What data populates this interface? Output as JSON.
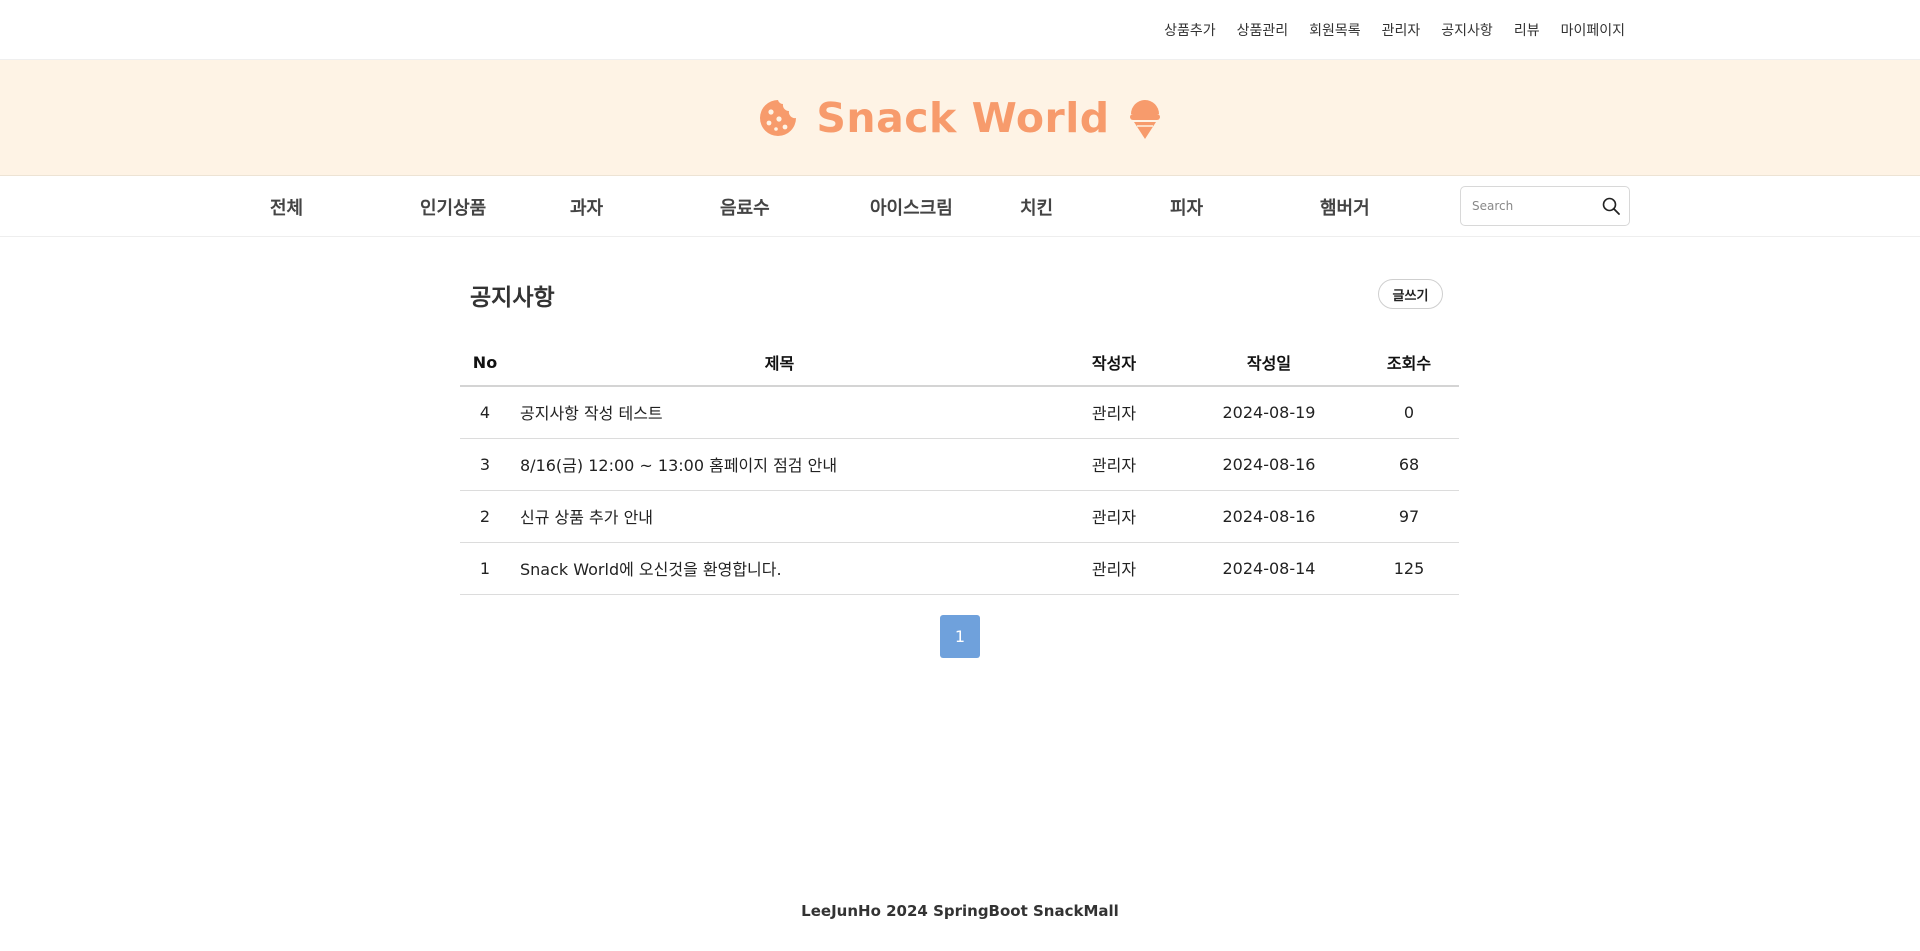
{
  "top_nav": [
    "상품추가",
    "상품관리",
    "회원목록",
    "관리자",
    "공지사항",
    "리뷰",
    "마이페이지"
  ],
  "brand": {
    "title": "Snack World",
    "color": "#f79b6c",
    "left_icon": "cookie-icon",
    "right_icon": "ice-cream-icon"
  },
  "categories": [
    "전체",
    "인기상품",
    "과자",
    "음료수",
    "아이스크림",
    "치킨",
    "피자",
    "햄버거"
  ],
  "search": {
    "placeholder": "Search",
    "icon": "search-icon"
  },
  "notice": {
    "title": "공지사항",
    "write_label": "글쓰기",
    "columns": [
      "No",
      "제목",
      "작성자",
      "작성일",
      "조회수"
    ],
    "rows": [
      {
        "no": "4",
        "title": "공지사항 작성 테스트",
        "author": "관리자",
        "date": "2024-08-19",
        "views": "0"
      },
      {
        "no": "3",
        "title": "8/16(금) 12:00 ~ 13:00 홈페이지 점검 안내",
        "author": "관리자",
        "date": "2024-08-16",
        "views": "68"
      },
      {
        "no": "2",
        "title": "신규 상품 추가 안내",
        "author": "관리자",
        "date": "2024-08-16",
        "views": "97"
      },
      {
        "no": "1",
        "title": "Snack World에 오신것을 환영합니다.",
        "author": "관리자",
        "date": "2024-08-14",
        "views": "125"
      }
    ]
  },
  "pagination": {
    "current": "1"
  },
  "footer": "LeeJunHo 2024 SpringBoot SnackMall",
  "colors": {
    "banner_bg": "#fef3e5",
    "accent": "#f79b6c",
    "page_button": "#6fa1dc"
  }
}
